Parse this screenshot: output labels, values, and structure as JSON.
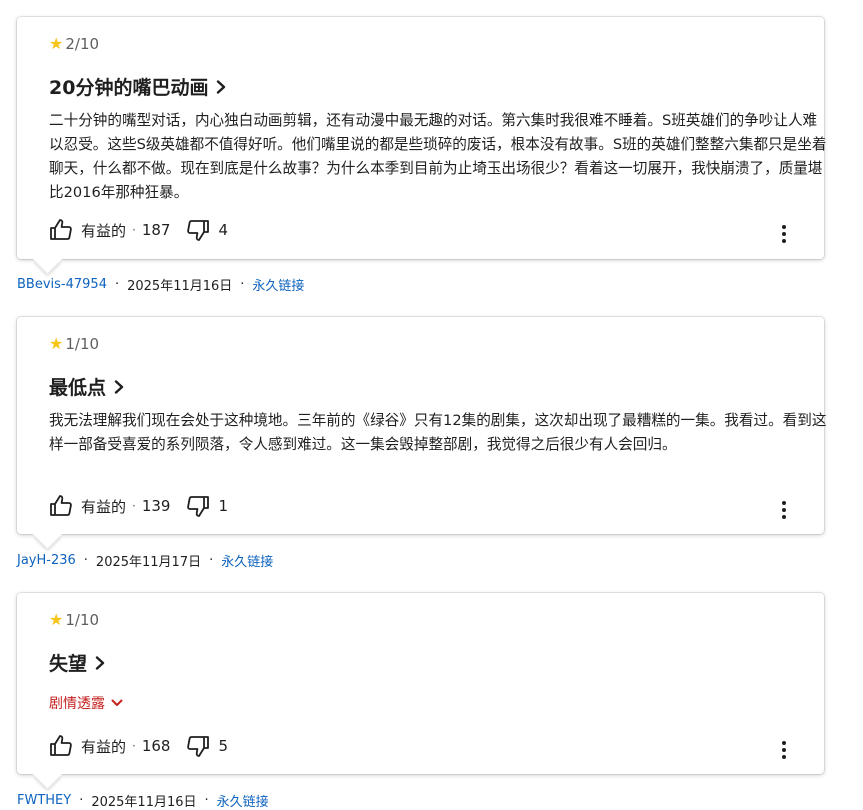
{
  "reviews": [
    {
      "rating": "2/10",
      "title": "20分钟的嘴巴动画",
      "body": "二十分钟的嘴型对话，内心独白动画剪辑，还有动漫中最无趣的对话。第六集时我很难不睡着。S班英雄们的争吵让人难以忍受。这些S级英雄都不值得好听。他们嘴里说的都是些琐碎的废话，根本没有故事。S班的英雄们整整六集都只是坐着聊天，什么都不做。现在到底是什么故事？为什么本季到目前为止埼玉出场很少？看着这一切展开，我快崩溃了，质量堪比2016年那种狂暴。",
      "helpful_label": "有益的",
      "upvotes": "187",
      "downvotes": "4",
      "author": "BBevis-47954",
      "date": "2025年11月16日",
      "permalink": "永久链接"
    },
    {
      "rating": "1/10",
      "title": "最低点",
      "body": "我无法理解我们现在会处于这种境地。三年前的《绿谷》只有12集的剧集，这次却出现了最糟糕的一集。我看过。看到这样一部备受喜爱的系列陨落，令人感到难过。这一集会毁掉整部剧，我觉得之后很少有人会回归。",
      "helpful_label": "有益的",
      "upvotes": "139",
      "downvotes": "1",
      "author": "JayH-236",
      "date": "2025年11月17日",
      "permalink": "永久链接"
    },
    {
      "rating": "1/10",
      "title": "失望",
      "spoiler_label": "剧情透露",
      "helpful_label": "有益的",
      "upvotes": "168",
      "downvotes": "5",
      "author": "FWTHEY",
      "date": "2025年11月16日",
      "permalink": "永久链接"
    }
  ],
  "meta_separator": "·",
  "colors": {
    "star": "#f5c518",
    "link": "#0e63be",
    "spoiler": "#c5221f"
  },
  "icons": {
    "star": "star-icon",
    "chevron": "chevron-right-icon",
    "thumb_up": "thumb-up-icon",
    "thumb_down": "thumb-down-icon",
    "more": "more-vert-icon",
    "spoiler_toggle": "chevron-down-icon"
  }
}
